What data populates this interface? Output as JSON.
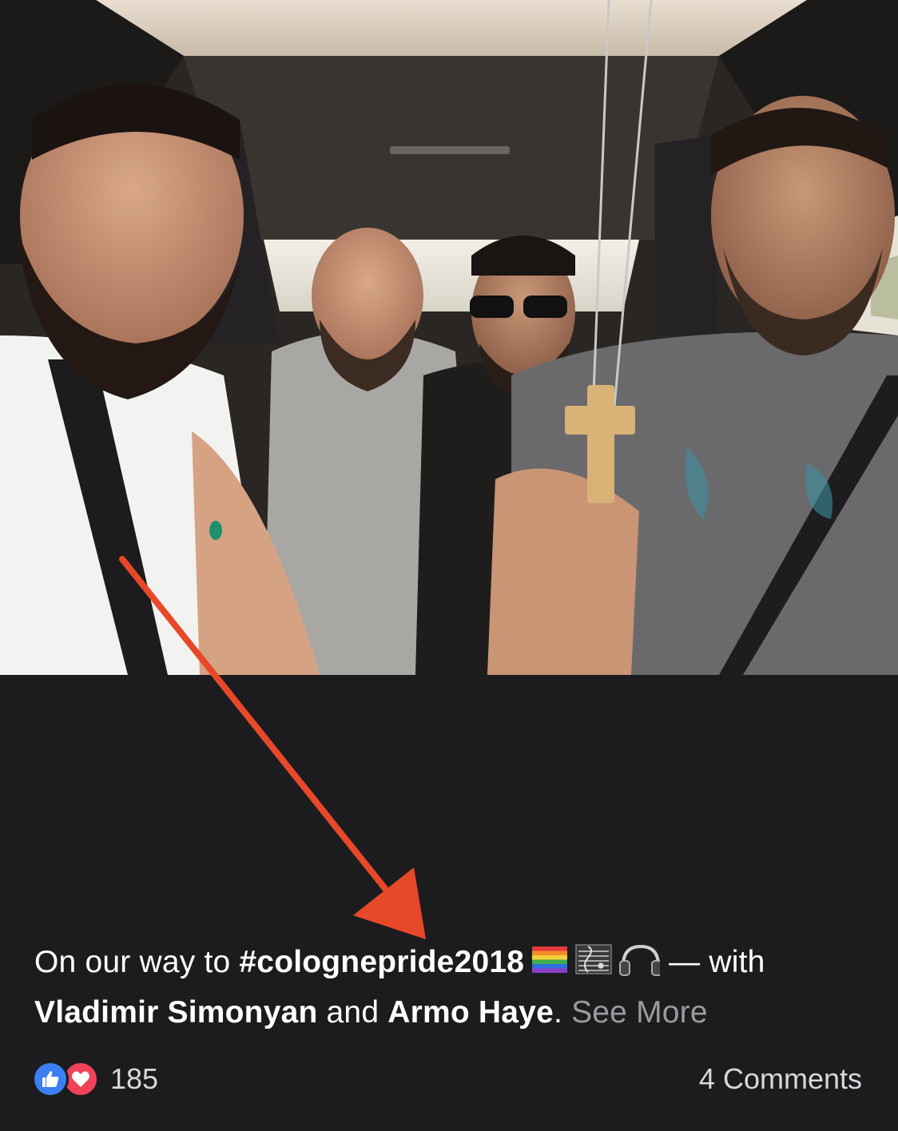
{
  "post": {
    "photo": {
      "alt": ""
    },
    "caption": {
      "lead": "On our way to ",
      "hashtag": "#colognepride2018",
      "emoji_icons": [
        "rainbow-flag-icon",
        "musical-score-icon",
        "headphones-icon"
      ],
      "with_text": " — with",
      "tag_1": "Vladimir Simonyan",
      "and_text": " and ",
      "tag_2": "Armo Haye",
      "period": ".",
      "see_more": "See More"
    },
    "reactions": {
      "icons": [
        "like-icon",
        "love-icon"
      ],
      "count": "185"
    },
    "comments": {
      "label": "4 Comments"
    }
  },
  "colors": {
    "background": "#1c1c1e",
    "text": "#ffffff",
    "muted_text": "#9b9b9f",
    "like_blue": "#3b7ff3",
    "love_red": "#f0425a",
    "annotation_arrow": "#e8482a"
  }
}
